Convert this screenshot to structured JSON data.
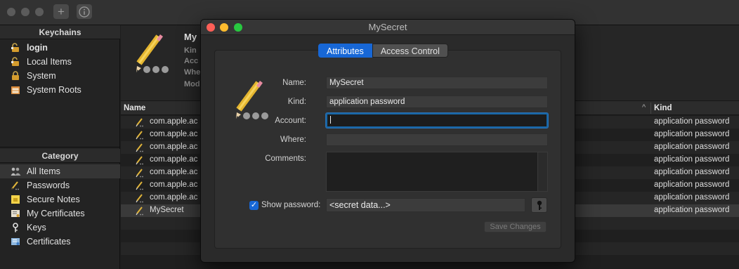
{
  "toolbar": {
    "add_icon": "plus-icon",
    "info_icon": "info-icon"
  },
  "sidebar": {
    "keychains_header": "Keychains",
    "keychains": [
      {
        "label": "login",
        "icon": "unlocked-padlock-icon"
      },
      {
        "label": "Local Items",
        "icon": "unlocked-padlock-icon"
      },
      {
        "label": "System",
        "icon": "locked-padlock-icon"
      },
      {
        "label": "System Roots",
        "icon": "cabinet-icon"
      }
    ],
    "category_header": "Category",
    "categories": [
      {
        "label": "All Items",
        "icon": "all-items-icon"
      },
      {
        "label": "Passwords",
        "icon": "pencil-icon"
      },
      {
        "label": "Secure Notes",
        "icon": "note-icon"
      },
      {
        "label": "My Certificates",
        "icon": "certificate-icon"
      },
      {
        "label": "Keys",
        "icon": "key-icon"
      },
      {
        "label": "Certificates",
        "icon": "certificate-icon"
      }
    ]
  },
  "detail": {
    "title": "My",
    "meta": [
      "Kin",
      "Acc",
      "Whe",
      "Mod"
    ]
  },
  "list": {
    "col_name": "Name",
    "col_kind": "Kind",
    "sort_glyph": "^",
    "rows": [
      {
        "name": "com.apple.ac",
        "kind": "application password"
      },
      {
        "name": "com.apple.ac",
        "kind": "application password"
      },
      {
        "name": "com.apple.ac",
        "kind": "application password"
      },
      {
        "name": "com.apple.ac",
        "kind": "application password"
      },
      {
        "name": "com.apple.ac",
        "kind": "application password"
      },
      {
        "name": "com.apple.ac",
        "kind": "application password"
      },
      {
        "name": "com.apple.ac",
        "kind": "application password"
      },
      {
        "name": "MySecret",
        "kind": "application password"
      }
    ]
  },
  "dialog": {
    "title": "MySecret",
    "tabs": {
      "attributes": "Attributes",
      "access_control": "Access Control"
    },
    "labels": {
      "name": "Name:",
      "kind": "Kind:",
      "account": "Account:",
      "where": "Where:",
      "comments": "Comments:",
      "show_password": "Show password:"
    },
    "values": {
      "name": "MySecret",
      "kind": "application password",
      "account": "",
      "where": "",
      "password": "<secret data...>"
    },
    "show_password_checked": true,
    "save_label": "Save Changes"
  },
  "colors": {
    "accent": "#1767d6",
    "close": "#fe5f57",
    "minimize": "#febc2e",
    "zoom": "#28c840"
  }
}
